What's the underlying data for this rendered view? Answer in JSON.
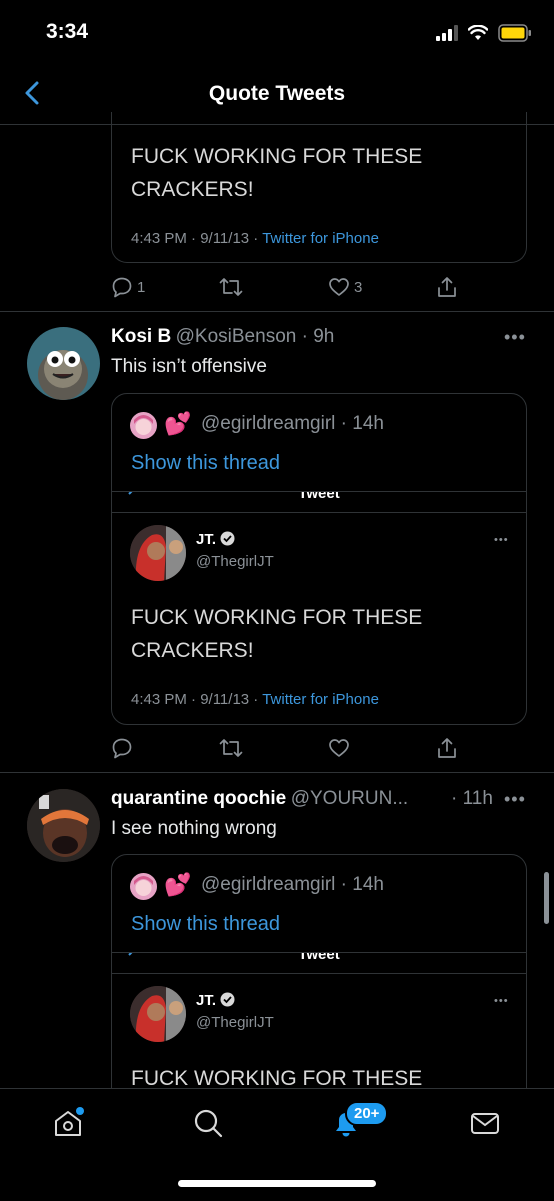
{
  "status_bar": {
    "time": "3:34"
  },
  "nav": {
    "title": "Quote Tweets"
  },
  "top_partial": {
    "text_line1": "FUCK WORKING FOR THESE",
    "text_line2": "CRACKERS!",
    "meta_time": "4:43 PM · 9/11/13 · ",
    "meta_source": "Twitter for iPhone",
    "reply_count": "1",
    "like_count": "3"
  },
  "tweets": [
    {
      "name": "Kosi B",
      "handle": "@KosiBenson · 9h",
      "text": "This isn’t offensive",
      "quote": {
        "emoji": "💕",
        "handle": "@egirldreamgirl · 14h",
        "show_thread": "Show this thread",
        "bar_label": "Tweet",
        "author_name": "JT.",
        "author_handle": "@ThegirlJT",
        "text_line1": "FUCK WORKING FOR THESE",
        "text_line2": "CRACKERS!",
        "meta_time": "4:43 PM · 9/11/13 · ",
        "meta_source": "Twitter for iPhone"
      }
    },
    {
      "name": "quarantine qoochie",
      "handle": "@YOURUN...",
      "time": "· 11h",
      "text": "I see nothing wrong",
      "quote": {
        "emoji": "💕",
        "handle": "@egirldreamgirl · 14h",
        "show_thread": "Show this thread",
        "bar_label": "Tweet",
        "author_name": "JT.",
        "author_handle": "@ThegirlJT",
        "text_line1": "FUCK WORKING FOR THESE"
      }
    }
  ],
  "tabbar": {
    "badge": "20+"
  },
  "colors": {
    "accent": "#3d97dc",
    "badge": "#1d9bf0",
    "divider": "#2f3336",
    "muted": "#8b9197"
  }
}
